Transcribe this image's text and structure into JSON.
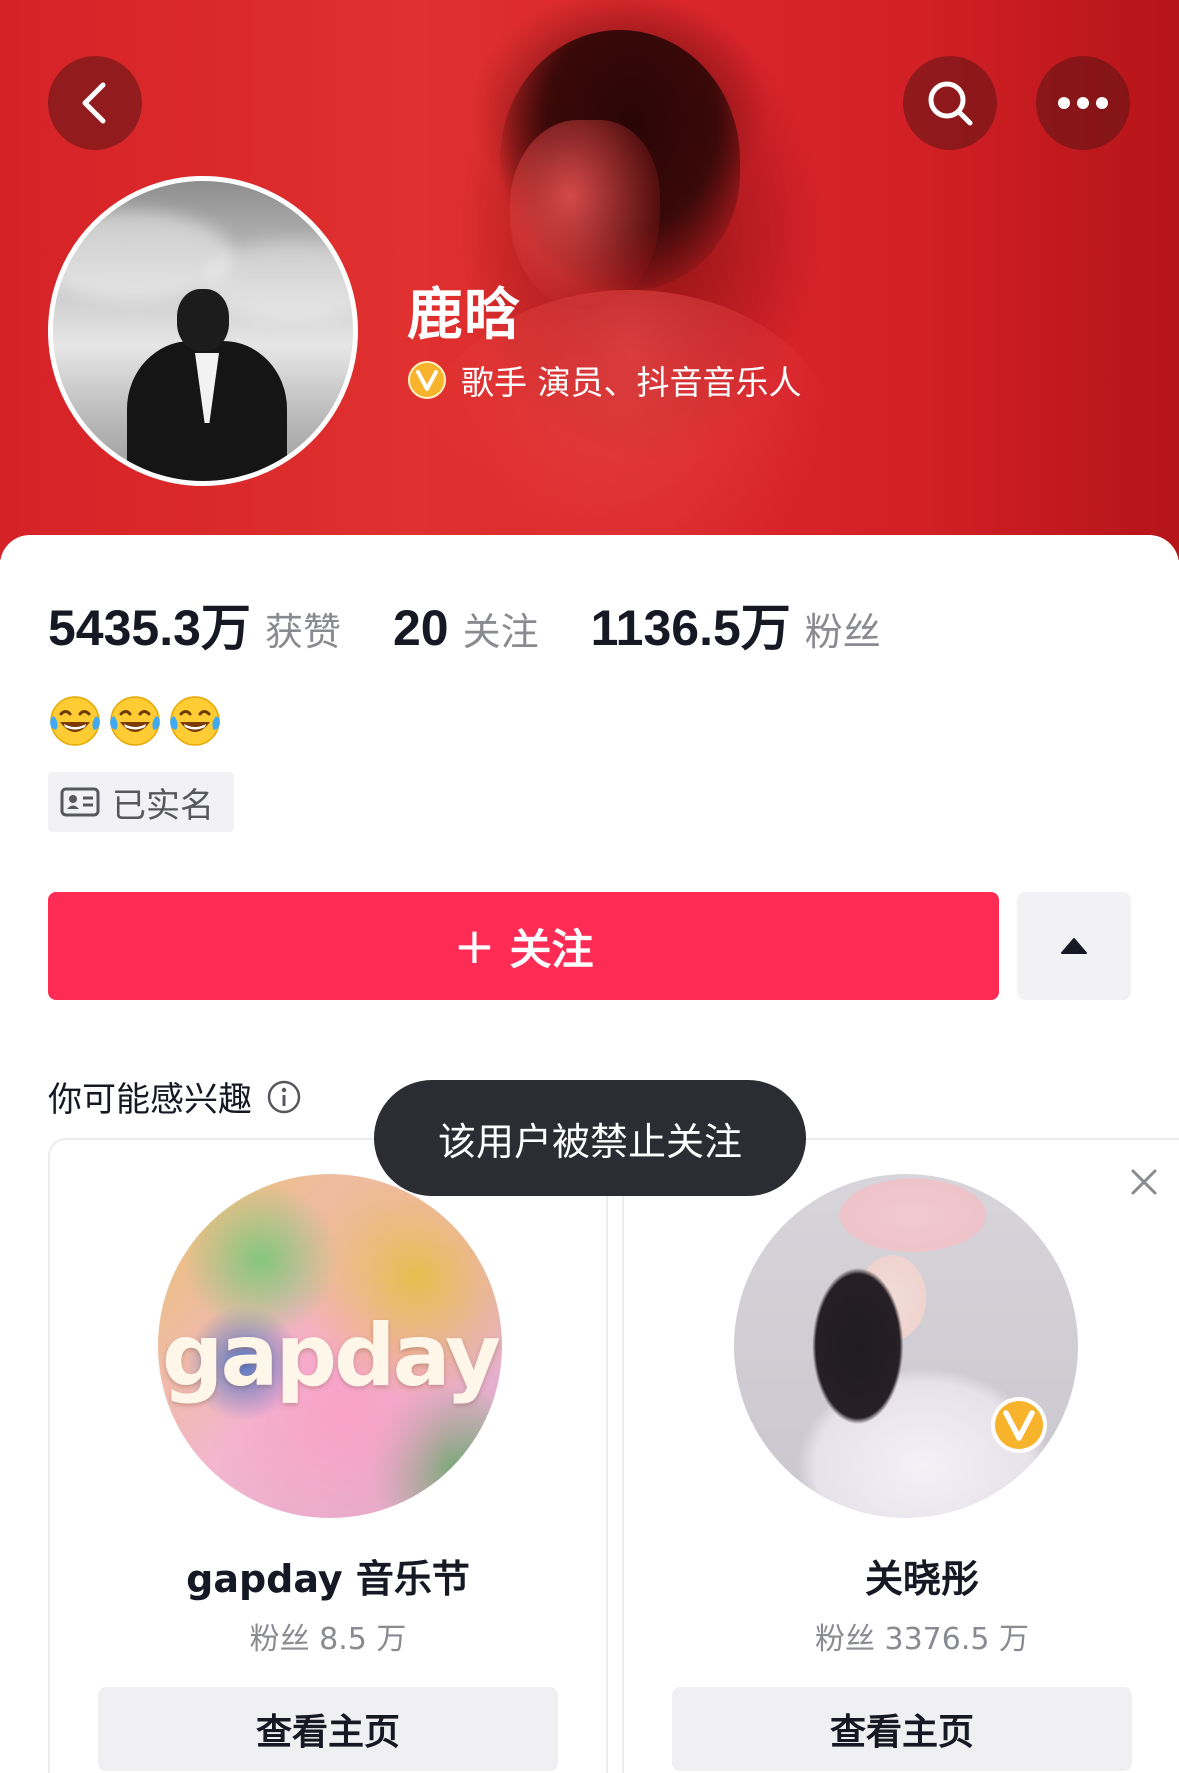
{
  "header": {
    "back_icon": "chevron-left-icon",
    "search_icon": "search-icon",
    "more_icon": "more-dots-icon"
  },
  "profile": {
    "name": "鹿晗",
    "verified_text": "歌手 演员、抖音音乐人",
    "verified_badge": "v-badge-icon",
    "stats": [
      {
        "value": "5435.3万",
        "label": "获赞"
      },
      {
        "value": "20",
        "label": "关注"
      },
      {
        "value": "1136.5万",
        "label": "粉丝"
      }
    ],
    "bio_emojis": [
      "laughing-tears-emoji",
      "laughing-tears-emoji",
      "laughing-tears-emoji"
    ],
    "real_name_label": "已实名"
  },
  "actions": {
    "follow_plus": "+",
    "follow_label": "关注",
    "follow_color": "#fe2c55",
    "expand_icon": "triangle-up-icon"
  },
  "suggestions": {
    "title": "你可能感兴趣",
    "cards": [
      {
        "avatar_text": "gapday",
        "name": "gapday 音乐节",
        "fans": "粉丝 8.5 万",
        "button": "查看主页"
      },
      {
        "name": "关晓彤",
        "fans": "粉丝 3376.5 万",
        "button": "查看主页",
        "verified": true
      }
    ]
  },
  "toast": {
    "message": "该用户被禁止关注"
  }
}
